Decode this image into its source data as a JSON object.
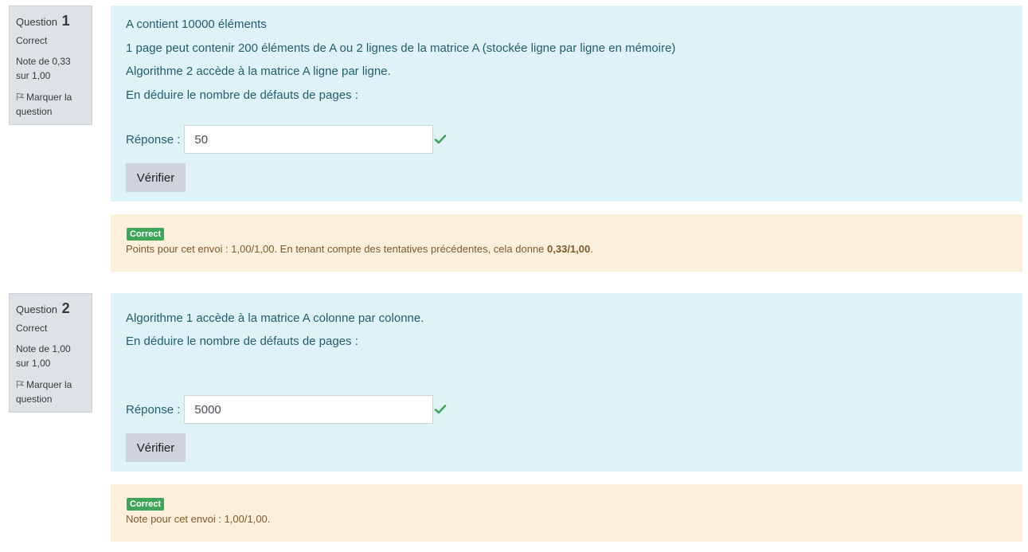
{
  "questions": [
    {
      "number_prefix": "Question",
      "number": "1",
      "state": "Correct",
      "grade": "Note de 0,33 sur 1,00",
      "flag_label": "Marquer la question",
      "text": [
        "A contient 10000 éléments",
        "1 page peut contenir 200 éléments de A ou 2 lignes de la matrice A (stockée ligne par ligne en mémoire)",
        "Algorithme 2 accède à la matrice A ligne par ligne.",
        "En déduire le nombre de défauts de pages :"
      ],
      "answer_label": "Réponse :",
      "answer_value": "50",
      "check_label": "Vérifier",
      "feedback_badge": "Correct",
      "feedback_text": "Points pour cet envoi : 1,00/1,00. En tenant compte des tentatives précédentes, cela donne ",
      "feedback_bold": "0,33/1,00",
      "feedback_end": "."
    },
    {
      "number_prefix": "Question",
      "number": "2",
      "state": "Correct",
      "grade": "Note de 1,00 sur 1,00",
      "flag_label": "Marquer la question",
      "text": [
        "Algorithme 1 accède à la matrice A colonne par colonne.",
        "En déduire le nombre de défauts de pages :"
      ],
      "answer_label": "Réponse :",
      "answer_value": "5000",
      "check_label": "Vérifier",
      "feedback_badge": "Correct",
      "feedback_text": "Note pour cet envoi : 1,00/1,00."
    }
  ],
  "colors": {
    "formulation_bg": "#def2f8",
    "feedback_bg": "#fcefdc",
    "info_bg": "#dee2e6",
    "badge_success": "#3fa55a",
    "check_green": "#3fa55a"
  },
  "icons": {
    "flag": "flag-icon",
    "check": "check-icon"
  }
}
